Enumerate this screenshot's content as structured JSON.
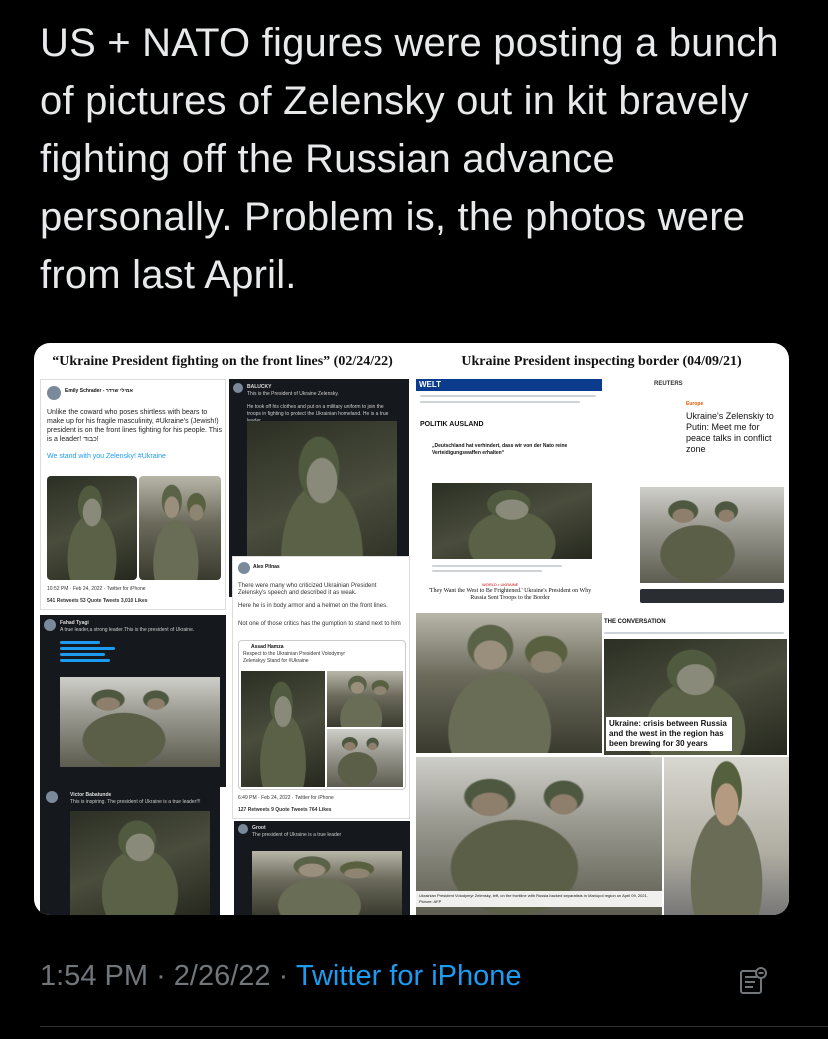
{
  "tweet": {
    "text": "US + NATO figures were posting a bunch of pictures of Zelensky out in kit bravely fighting off the Russian advance personally. Problem is, the photos were from last April.",
    "time": "1:54 PM",
    "date": "2/26/22",
    "separator": "·",
    "source": "Twitter for iPhone"
  },
  "media": {
    "left_title": "“Ukraine President fighting on the front lines” (02/24/22)",
    "right_title": "Ukraine President inspecting border (04/09/21)",
    "left": {
      "tweet1": {
        "name": "Emily Schrader - אמילי שרדר",
        "body": "Unlike the coward who poses shirtless with bears to make up for his fragile masculinity, #Ukraine's (Jewish!) president is on the front lines fighting for his people. This is a leader! כבוד!",
        "body2": "We stand with you Zelensky! #Ukraine",
        "footer": "10:52 PM · Feb 24, 2022 · Twitter for iPhone",
        "stats": "541 Retweets   53 Quote Tweets   3,010 Likes"
      },
      "tweet2": {
        "name": "BALUCKY",
        "body": "This is the President of Ukraine Zelensky.",
        "body2": "He took off his clothes and put on a military uniform to join the troops in fighting to protect the Ukrainian homeland. He is a true leader."
      },
      "tweet3": {
        "name": "Alex Pilnas",
        "body": "There were many who criticized Ukrainian President Zelensky's speech and described it as weak.",
        "body2": "Here he is in body armor and a helmet on the front lines.",
        "body3": "Not one of those critics has the gumption to stand next to him",
        "quote_name": "Assad Hamza",
        "quote": "Respect to the Ukrainian President Volodymyr Zelenskyy Stand for #Ukraine",
        "footer": "6:49 PM · Feb 24, 2022 · Twitter for iPhone",
        "stats": "127 Retweets   9 Quote Tweets   764 Likes"
      },
      "tweet4": {
        "name": "Fahad Tyagi",
        "body": "A true leader,a strong leader.This is the president of Ukraine."
      },
      "tweet5": {
        "name": "Victor Babatunde",
        "body": "This is inspiring. The president of Ukraine is a true leader!!!"
      },
      "tweet6": {
        "name": "Groot",
        "body": "The president of Ukraine is a true leader"
      }
    },
    "right": {
      "welt": {
        "logo": "WELT",
        "section": "POLITIK AUSLAND",
        "headline": "„Deutschland hat verhindert, dass wir von der Nato reine Verteidigungswaffen erhalten“"
      },
      "reuters": {
        "logo": "REUTERS",
        "tag": "Europe",
        "headline": "Ukraine's Zelenskiy to Putin: Meet me for peace talks in conflict zone"
      },
      "world": {
        "tag": "WORLD • UKRAINE",
        "headline": "'They Want the West to Be Frightened.' Ukraine's President on Why Russia Sent Troops to the Border"
      },
      "conversation": {
        "logo": "THE CONVERSATION",
        "caption": "Ukraine: crisis between Russia and the west in the region has been brewing for 30 years"
      },
      "bottom_caption": "Ukrainian President Volodymyr Zelensky, left, on the frontline with Russia backed separatists in Mariupol region on April 09, 2021. Picture: AFP"
    }
  },
  "icons": {
    "analytics": "analytics-icon"
  },
  "colors": {
    "background": "#000000",
    "text": "#e7e9ea",
    "muted": "#71767b",
    "link": "#1d9bf0"
  }
}
